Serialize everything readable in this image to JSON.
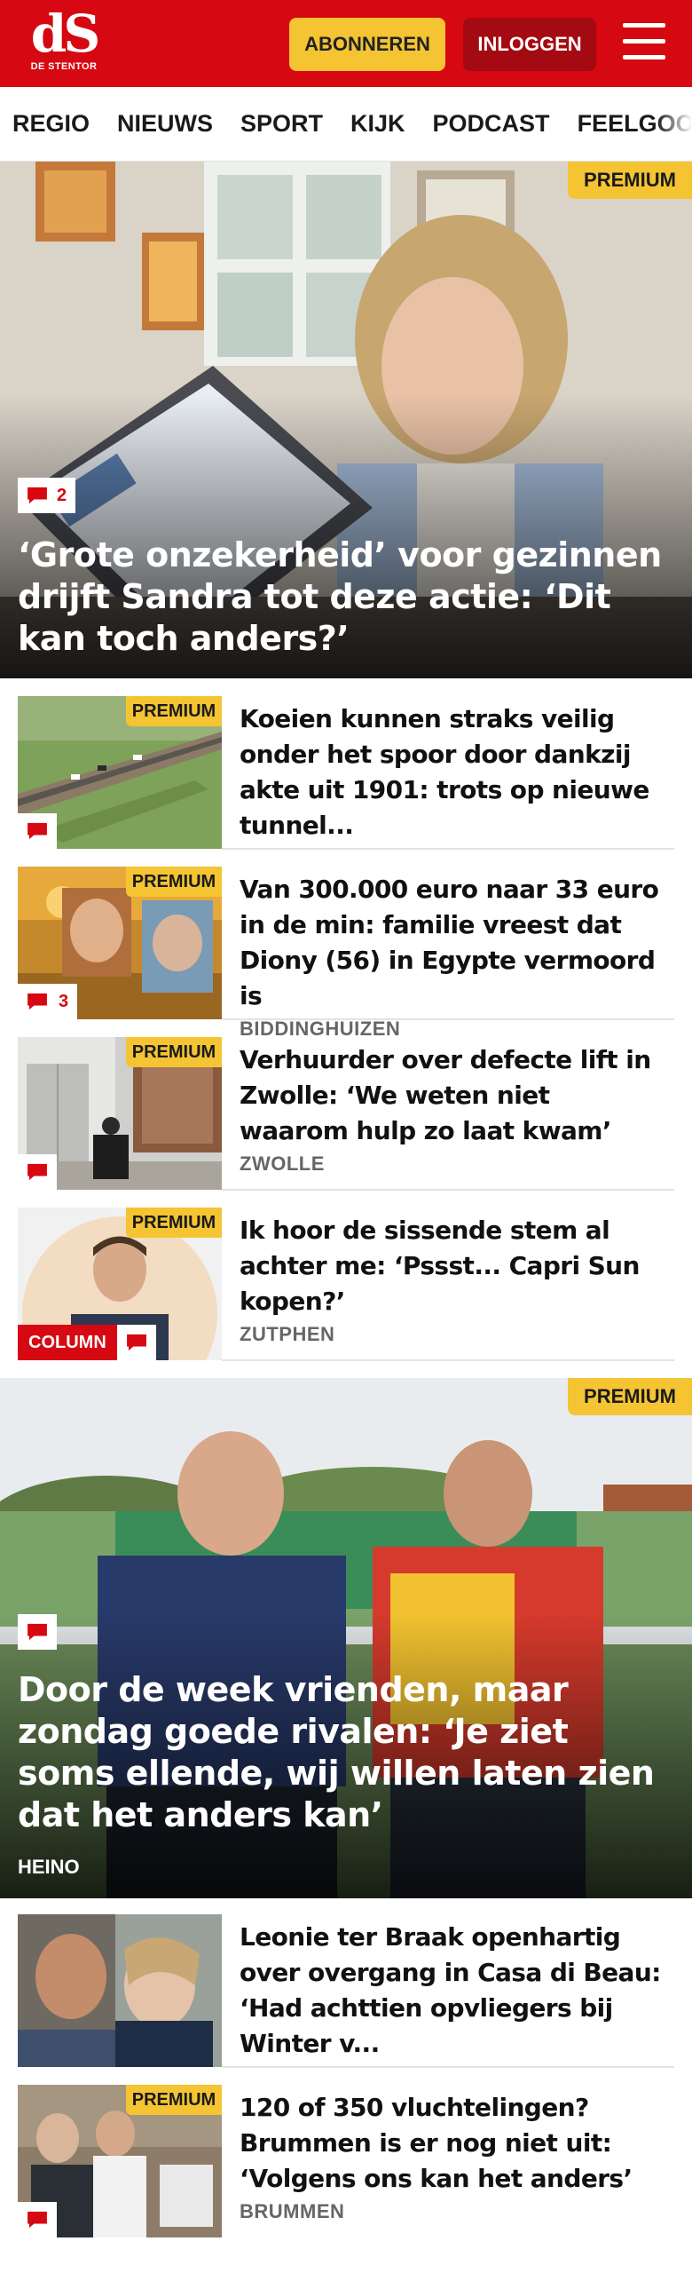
{
  "header": {
    "logo_text": "dS",
    "logo_subtitle": "DE STENTOR",
    "subscribe_label": "ABONNEREN",
    "login_label": "INLOGGEN",
    "brand_color": "#d60811",
    "accent_color": "#f5c433"
  },
  "nav": {
    "items": [
      "REGIO",
      "NIEUWS",
      "SPORT",
      "KIJK",
      "PODCAST",
      "FEELGOOD"
    ]
  },
  "premium_label": "PREMIUM",
  "column_label": "COLUMN",
  "hero1": {
    "title": "‘Grote onzekerheid’ voor gezinnen drijft Sandra tot deze actie: ‘Dit kan toch anders?’",
    "comments": "2"
  },
  "articles": [
    {
      "title": "Koeien kunnen straks veilig onder het spoor door dankzij akte uit 1901: trots op nieuwe tunnel...",
      "location": "",
      "comments": ""
    },
    {
      "title": "Van 300.000 euro naar 33 euro in de min: familie vreest dat Diony (56) in Egypte vermoord is",
      "location": "BIDDINGHUIZEN",
      "comments": "3"
    },
    {
      "title": "Verhuurder over defecte lift in Zwolle: ‘We weten niet waarom hulp zo laat kwam’",
      "location": "ZWOLLE",
      "comments": ""
    },
    {
      "title": "Ik hoor de sissende stem al achter me: ‘Pssst... Capri Sun kopen?’",
      "location": "ZUTPHEN",
      "comments": ""
    }
  ],
  "hero2": {
    "title": "Door de week vrienden, maar zondag goede rivalen: ‘Je ziet soms ellende, wij willen laten zien dat het anders kan’",
    "location": "HEINO"
  },
  "articles2": [
    {
      "title": "Leonie ter Braak openhartig over overgang in Casa di Beau: ‘Had achttien opvliegers bij Winter v...",
      "location": ""
    },
    {
      "title": "120 of 350 vluchtelingen? Brummen is er nog niet uit: ‘Volgens ons kan het anders’",
      "location": "BRUMMEN"
    }
  ]
}
